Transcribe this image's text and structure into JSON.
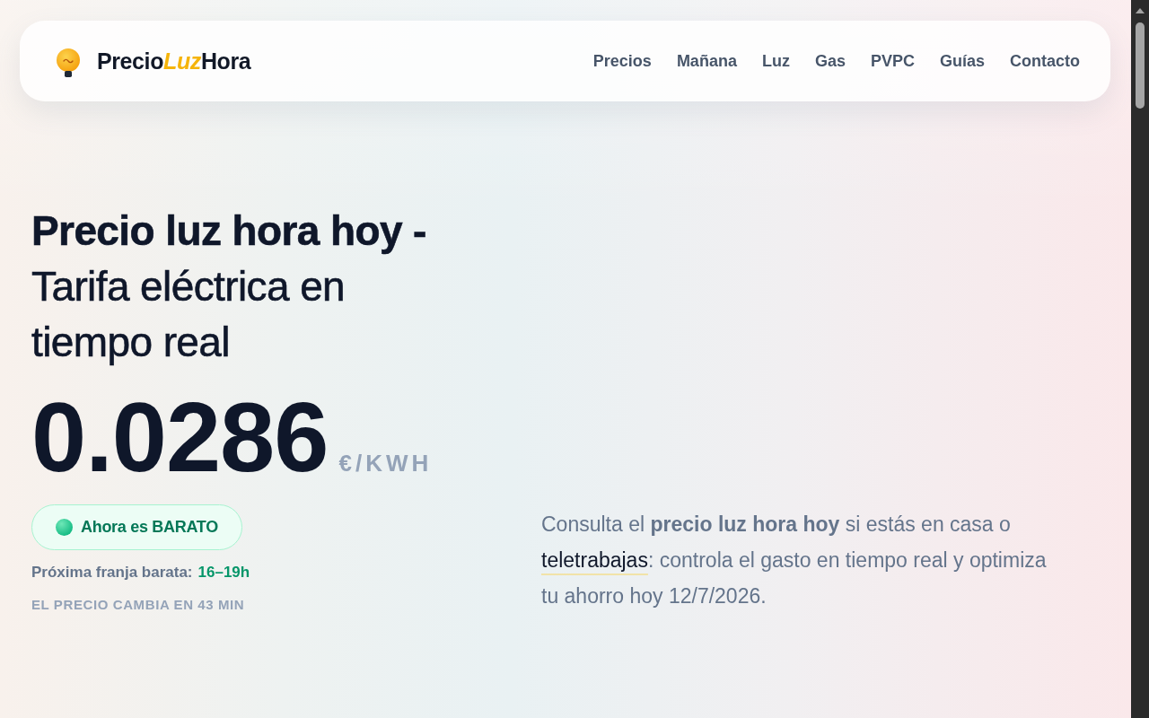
{
  "header": {
    "logo": [
      {
        "text": "Precio",
        "accent": false
      },
      {
        "text": "Luz",
        "accent": true
      },
      {
        "text": "Hora",
        "accent": false
      }
    ],
    "nav": [
      "Precios",
      "Mañana",
      "Luz",
      "Gas",
      "PVPC",
      "Guías",
      "Contacto"
    ]
  },
  "hero": {
    "title": "**Precio luz hora hoy -** Tarifa eléctrica en tiempo real",
    "price": {
      "value": "0.0286",
      "unit": "€/KWH"
    },
    "status": {
      "kind": "cheap",
      "label": "Ahora es BARATO"
    },
    "next_cheap": {
      "label": "Próxima franja barata:",
      "value": "16–19h"
    },
    "countdown": "EL PRECIO CAMBIA EN 43 MIN",
    "intro": {
      "before": "Consulta el **precio luz hora hoy** si estás en casa o",
      "link": "teletrabajas",
      "after": ": controla el gasto en tiempo real y optimiza tu ahorro hoy 12/7/2026."
    }
  }
}
